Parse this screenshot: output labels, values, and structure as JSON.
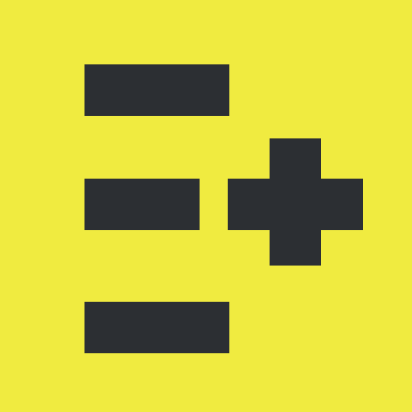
{
  "app_icon": {
    "name": "add-to-list-icon",
    "colors": {
      "background": "#f0eb40",
      "foreground": "#2c2f33"
    }
  }
}
